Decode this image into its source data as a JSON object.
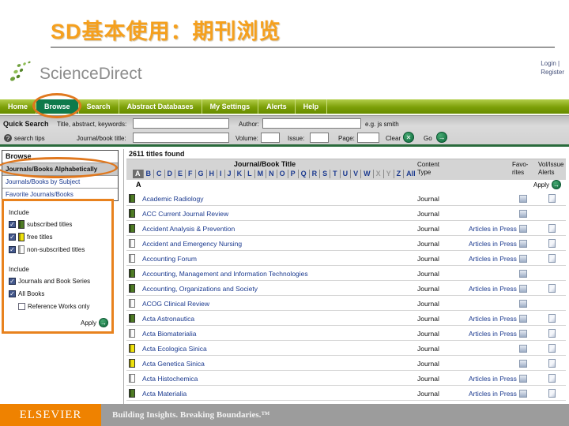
{
  "slide": {
    "title": "SD基本使用：期刊浏览"
  },
  "colors": {
    "title_orange": "#F5A01E",
    "annotation_orange": "#E0781E",
    "nav_green": "#7C9F08",
    "active_tab_green": "#0F7A4B",
    "link_navy": "#1B3A8F",
    "footer_orange": "#EF8200",
    "footer_gray": "#9C9C9C"
  },
  "header": {
    "logo_text": "ScienceDirect",
    "login": "Login |",
    "register": "Register"
  },
  "nav": {
    "tabs": [
      {
        "label": "Home",
        "active": false
      },
      {
        "label": "Browse",
        "active": true
      },
      {
        "label": "Search",
        "active": false
      },
      {
        "label": "Abstract Databases",
        "active": false
      },
      {
        "label": "My Settings",
        "active": false
      },
      {
        "label": "Alerts",
        "active": false
      },
      {
        "label": "Help",
        "active": false
      }
    ]
  },
  "quick_search": {
    "label": "Quick Search",
    "title_field_label": "Title, abstract, keywords:",
    "author_label": "Author:",
    "author_hint": "e.g. js smith",
    "tips_icon": "?",
    "tips_label": "search tips",
    "journal_field_label": "Journal/book title:",
    "volume_label": "Volume:",
    "issue_label": "Issue:",
    "page_label": "Page:",
    "clear_label": "Clear",
    "go_label": "Go"
  },
  "browse_menu": {
    "header": "Browse",
    "items": [
      {
        "label": "Journals/Books Alphabetically",
        "selected": true
      },
      {
        "label": "Journals/Books by Subject",
        "selected": false
      },
      {
        "label": "Favorite Journals/Books",
        "selected": false
      }
    ]
  },
  "filters": {
    "groups": [
      {
        "label": "Include",
        "options": [
          {
            "label": "subscribed titles",
            "icon": "green-book",
            "checked": true
          },
          {
            "label": "free titles",
            "icon": "yellow-book",
            "checked": true
          },
          {
            "label": "non-subscribed titles",
            "icon": "white-book",
            "checked": true
          }
        ]
      },
      {
        "label": "Include",
        "options": [
          {
            "label": "Journals and Book Series",
            "checked": true
          },
          {
            "label": "All Books",
            "checked": true
          },
          {
            "label": "Reference Works only",
            "checked": false,
            "indent": true
          }
        ]
      }
    ],
    "apply_label": "Apply"
  },
  "results": {
    "count_text": "2611 titles found",
    "column_title": "Journal/Book Title",
    "alphabet": [
      {
        "label": "A",
        "state": "selected"
      },
      {
        "label": "B",
        "state": "link"
      },
      {
        "label": "C",
        "state": "link"
      },
      {
        "label": "D",
        "state": "link"
      },
      {
        "label": "E",
        "state": "link"
      },
      {
        "label": "F",
        "state": "link"
      },
      {
        "label": "G",
        "state": "link"
      },
      {
        "label": "H",
        "state": "link"
      },
      {
        "label": "I",
        "state": "link"
      },
      {
        "label": "J",
        "state": "link"
      },
      {
        "label": "K",
        "state": "link"
      },
      {
        "label": "L",
        "state": "link"
      },
      {
        "label": "M",
        "state": "link"
      },
      {
        "label": "N",
        "state": "link"
      },
      {
        "label": "O",
        "state": "link"
      },
      {
        "label": "P",
        "state": "link"
      },
      {
        "label": "Q",
        "state": "link"
      },
      {
        "label": "R",
        "state": "link"
      },
      {
        "label": "S",
        "state": "link"
      },
      {
        "label": "T",
        "state": "link"
      },
      {
        "label": "U",
        "state": "link"
      },
      {
        "label": "V",
        "state": "link"
      },
      {
        "label": "W",
        "state": "link"
      },
      {
        "label": "X",
        "state": "disabled"
      },
      {
        "label": "Y",
        "state": "disabled"
      },
      {
        "label": "Z",
        "state": "link"
      },
      {
        "label": "All",
        "state": "link"
      }
    ],
    "headers": {
      "content_type": "Content Type",
      "favorites": "Favo-rites",
      "alerts": "Vol/Issue Alerts"
    },
    "section_letter": "A",
    "apply_label": "Apply",
    "aip_label": "Articles in Press",
    "rows": [
      {
        "title": "Academic Radiology",
        "icon": "green-book",
        "type": "Journal",
        "aip": false,
        "fav": true,
        "alert": true
      },
      {
        "title": "ACC Current Journal Review",
        "icon": "green-book",
        "type": "Journal",
        "aip": false,
        "fav": true,
        "alert": false
      },
      {
        "title": "Accident Analysis & Prevention",
        "icon": "green-book",
        "type": "Journal",
        "aip": true,
        "fav": true,
        "alert": true
      },
      {
        "title": "Accident and Emergency Nursing",
        "icon": "white-book",
        "type": "Journal",
        "aip": true,
        "fav": true,
        "alert": true
      },
      {
        "title": "Accounting Forum",
        "icon": "white-book",
        "type": "Journal",
        "aip": true,
        "fav": true,
        "alert": true
      },
      {
        "title": "Accounting, Management and Information Technologies",
        "icon": "green-book",
        "type": "Journal",
        "aip": false,
        "fav": true,
        "alert": false
      },
      {
        "title": "Accounting, Organizations and Society",
        "icon": "green-book",
        "type": "Journal",
        "aip": true,
        "fav": true,
        "alert": true
      },
      {
        "title": "ACOG Clinical Review",
        "icon": "white-book",
        "type": "Journal",
        "aip": false,
        "fav": true,
        "alert": false
      },
      {
        "title": "Acta Astronautica",
        "icon": "green-book",
        "type": "Journal",
        "aip": true,
        "fav": true,
        "alert": true
      },
      {
        "title": "Acta Biomaterialia",
        "icon": "white-book",
        "type": "Journal",
        "aip": true,
        "fav": true,
        "alert": true
      },
      {
        "title": "Acta Ecologica Sinica",
        "icon": "yellow-book",
        "type": "Journal",
        "aip": false,
        "fav": true,
        "alert": true
      },
      {
        "title": "Acta Genetica Sinica",
        "icon": "yellow-book",
        "type": "Journal",
        "aip": false,
        "fav": true,
        "alert": true
      },
      {
        "title": "Acta Histochemica",
        "icon": "white-book",
        "type": "Journal",
        "aip": true,
        "fav": true,
        "alert": true
      },
      {
        "title": "Acta Materialia",
        "icon": "green-book",
        "type": "Journal",
        "aip": true,
        "fav": true,
        "alert": true
      }
    ]
  },
  "footer": {
    "brand": "ELSEVIER",
    "tagline": "Building Insights. Breaking Boundaries.™"
  }
}
